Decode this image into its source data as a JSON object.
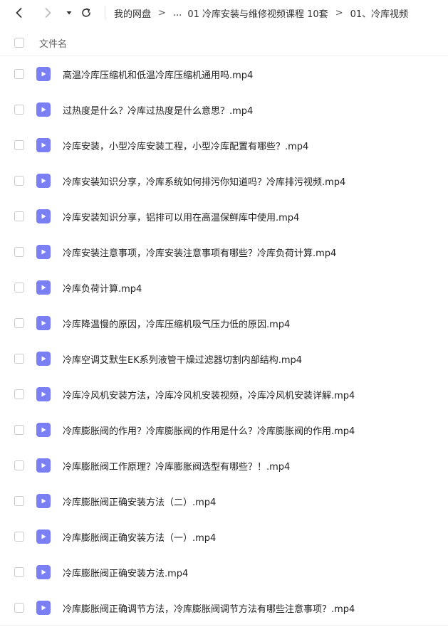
{
  "toolbar": {
    "back_icon": "chevron-left-icon",
    "forward_icon": "chevron-right-icon",
    "dropdown_icon": "caret-down-icon",
    "refresh_icon": "refresh-icon",
    "breadcrumb": {
      "root": "我的网盘",
      "separator": ">",
      "ellipsis": "...",
      "folder": "01 冷库安装与维修视频课程 10套",
      "current": "01、冷库视频"
    }
  },
  "list_header": {
    "column_name": "文件名"
  },
  "files": [
    {
      "name": "高温冷库压缩机和低温冷库压缩机通用吗.mp4"
    },
    {
      "name": "过热度是什么？冷库过热度是什么意思？.mp4"
    },
    {
      "name": "冷库安装，小型冷库安装工程，小型冷库配置有哪些？.mp4"
    },
    {
      "name": "冷库安装知识分享，冷库系统如何排污你知道吗？冷库排污视频.mp4"
    },
    {
      "name": "冷库安装知识分享，铝排可以用在高温保鲜库中使用.mp4"
    },
    {
      "name": "冷库安装注意事项，冷库安装注意事项有哪些？冷库负荷计算.mp4"
    },
    {
      "name": "冷库负荷计算.mp4"
    },
    {
      "name": "冷库降温慢的原因，冷库压缩机吸气压力低的原因.mp4"
    },
    {
      "name": "冷库空调艾默生EK系列液管干燥过滤器切割内部结构.mp4"
    },
    {
      "name": "冷库冷风机安装方法，冷库冷风机安装视频，冷库冷风机安装详解.mp4"
    },
    {
      "name": "冷库膨胀阀的作用？冷库膨胀阀的作用是什么？冷库膨胀阀的作用.mp4"
    },
    {
      "name": "冷库膨胀阀工作原理？冷库膨胀阀选型有哪些？！.mp4"
    },
    {
      "name": "冷库膨胀阀正确安装方法（二）.mp4"
    },
    {
      "name": "冷库膨胀阀正确安装方法（一）.mp4"
    },
    {
      "name": "冷库膨胀阀正确安装方法.mp4"
    },
    {
      "name": "冷库膨胀阀正确调节方法，冷库膨胀阀调节方法有哪些注意事项？.mp4"
    }
  ],
  "colors": {
    "video_icon": "#7a80f4",
    "checkbox_border": "#c9c9cf"
  },
  "file_icon": "video-file-icon"
}
